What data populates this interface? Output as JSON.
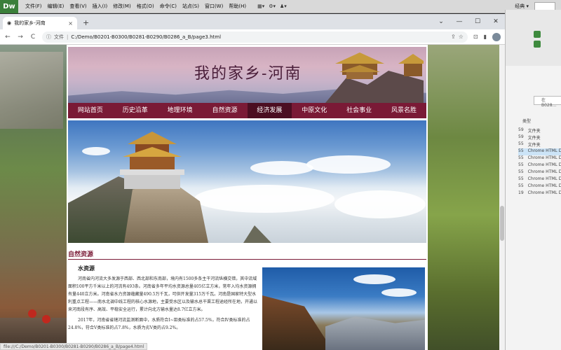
{
  "dw": {
    "logo": "Dw",
    "menu": [
      "文件(F)",
      "编辑(E)",
      "查看(V)",
      "插入(I)",
      "修改(M)",
      "格式(O)",
      "命令(C)",
      "站点(S)",
      "窗口(W)",
      "帮助(H)"
    ],
    "tools": [
      "▦▾",
      "⚙▾",
      "♟▾"
    ],
    "workspace": "经典 ▾"
  },
  "chrome": {
    "tab_title": "我的家乡-河南",
    "tab_close": "×",
    "new_tab": "+",
    "nav": {
      "back": "←",
      "forward": "→",
      "reload": "C"
    },
    "omnibox": {
      "info_icon": "ⓘ",
      "label": "文件",
      "separator": "|",
      "url": "C:/Demo/B0201-B0300/B0281-B0290/B0286_a_B/page3.html"
    },
    "addr_icons": [
      "⇪",
      "☆",
      "⊡",
      "▮"
    ],
    "window_controls": [
      "⌄",
      "—",
      "☐",
      "✕"
    ],
    "status_link": "file:///C:/Demo/B0201-B0300/B0281-B0290/B0286_a_B/page4.html"
  },
  "page": {
    "banner_title": "我的家乡-河南",
    "nav": [
      "网站首页",
      "历史沿革",
      "地理环境",
      "自然资源",
      "经济发展",
      "中原文化",
      "社会事业",
      "风景名胜"
    ],
    "active_nav_index": 4,
    "section_title": "自然资源",
    "article": {
      "subtitle": "水资源",
      "paragraphs": [
        "河南省内河流大多发源于西部、西北部和东南部，境内有1500多条主干河流纵横交错，其中流域面积100平方千米以上的河流有493条。河南省多年平均水资源总量405亿立方米，常年入均水资源拥有量440立方米。河南省水力资源蕴藏量490.5万千瓦，可供开发量315万千瓦。河南是国家特大型水利重点工程——南水北调中线工程的核心水源地，主要受水区以及输水总干渠工程途经所在地，开通以来河南段有序、高效、平稳安全运行，累计向北方输水量达8.7亿立方米。",
        "2017年，河南省省辖河流监测断面中，水质符合Ⅰ~Ⅲ类标准的占57.5%，符合Ⅳ类标准的占24.8%，符合Ⅴ类标准的占7.8%，水质为劣Ⅴ类的占9.2%。"
      ]
    }
  },
  "explorer": {
    "search_placeholder": "在 B028...",
    "column_header": "类型",
    "rows": [
      {
        "date": "59",
        "type": "文件夹"
      },
      {
        "date": "59",
        "type": "文件夹"
      },
      {
        "date": "55",
        "type": "文件夹"
      },
      {
        "date": "55",
        "type": "Chrome HTML D..."
      },
      {
        "date": "55",
        "type": "Chrome HTML D..."
      },
      {
        "date": "55",
        "type": "Chrome HTML D..."
      },
      {
        "date": "55",
        "type": "Chrome HTML D..."
      },
      {
        "date": "55",
        "type": "Chrome HTML D..."
      },
      {
        "date": "55",
        "type": "Chrome HTML D..."
      },
      {
        "date": "19",
        "type": "Chrome HTML D..."
      }
    ],
    "selected_row": 3
  },
  "colors": {
    "nav_bg": "#7a1a36",
    "nav_active": "#4b0e22",
    "title": "#4a1e3a"
  }
}
